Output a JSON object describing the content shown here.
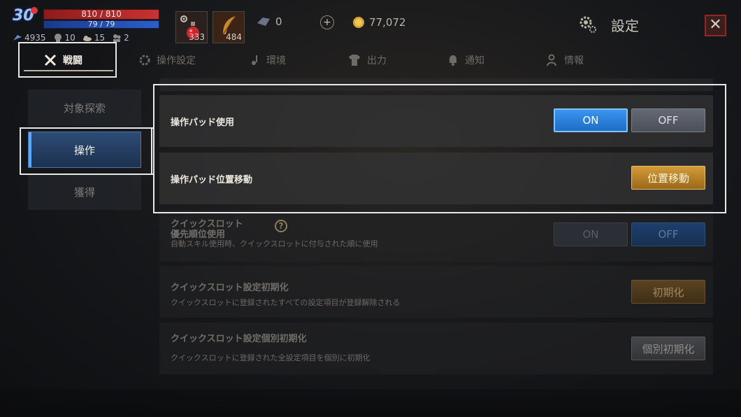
{
  "player": {
    "level": "30",
    "hp": "810 / 810",
    "mp": "79 / 79",
    "stats": [
      "4935",
      "10",
      "15",
      "2"
    ]
  },
  "items": [
    {
      "icon": "potion-icon",
      "count": "333"
    },
    {
      "icon": "feather-icon",
      "count": "484"
    }
  ],
  "currencies": {
    "gem": "0",
    "gold": "77,072",
    "add": "+"
  },
  "header": {
    "title": "設定",
    "close": "✕"
  },
  "tabs": [
    {
      "label": "戦闘",
      "icon": "crossed-swords-icon",
      "active": true
    },
    {
      "label": "操作設定",
      "icon": "gear-icon"
    },
    {
      "label": "環境",
      "icon": "music-note-icon"
    },
    {
      "label": "出力",
      "icon": "shirt-icon"
    },
    {
      "label": "通知",
      "icon": "bell-icon"
    },
    {
      "label": "情報",
      "icon": "person-icon"
    }
  ],
  "sidebar": [
    {
      "label": "対象探索"
    },
    {
      "label": "操作",
      "active": true
    },
    {
      "label": "獲得"
    }
  ],
  "settings": {
    "pad_use": {
      "title": "操作パッド使用",
      "on": "ON",
      "off": "OFF",
      "state": "ON"
    },
    "pad_move": {
      "title": "操作パッド位置移動",
      "button": "位置移動"
    },
    "quickslot_priority": {
      "title_line1": "クイックスロット",
      "title_line2": "優先順位使用",
      "desc": "自動スキル使用時、クイックスロットに付与された順に使用",
      "on": "ON",
      "off": "OFF",
      "state": "OFF"
    },
    "quickslot_reset": {
      "title": "クイックスロット設定初期化",
      "desc": "クイックスロットに登録されたすべての設定項目が登録解除される",
      "button": "初期化"
    },
    "quickslot_reset_individual": {
      "title": "クイックスロット設定個別初期化",
      "desc": "クイックスロットに登録された全設定項目を個別に初期化",
      "button": "個別初期化"
    }
  },
  "colors": {
    "on_active": "#2a82e0",
    "gold_button": "#c28a2c",
    "hp": "#c93232",
    "mp": "#2c5fc9",
    "close_border": "#8e2a26"
  }
}
